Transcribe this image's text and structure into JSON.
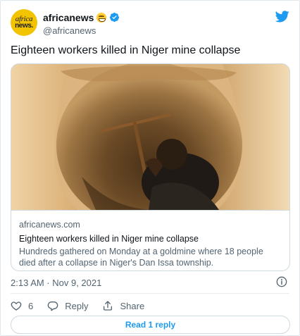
{
  "account": {
    "logo_line1": "africa",
    "logo_line2": "news.",
    "display_name": "africanews",
    "handle": "@africanews",
    "emoji_icon": "smiling-face-icon",
    "verified_icon": "verified-badge-icon",
    "brand_icon": "twitter-bird-icon"
  },
  "tweet": {
    "text": "Eighteen workers killed in Niger mine collapse",
    "timestamp": "2:13 AM · Nov 9, 2021"
  },
  "card": {
    "domain": "africanews.com",
    "title": "Eighteen workers killed in Niger mine collapse",
    "description": "Hundreds gathered on Monday at a goldmine where 18 people died after a collapse in Niger's Dan Issa township."
  },
  "actions": {
    "like_count": "6",
    "reply_label": "Reply",
    "share_label": "Share"
  },
  "read_replies_label": "Read 1 reply",
  "colors": {
    "accent": "#1d9bf0",
    "text_primary": "#0f1419",
    "text_secondary": "#536471",
    "border": "#cfd9de",
    "avatar_bg": "#f2c400"
  }
}
